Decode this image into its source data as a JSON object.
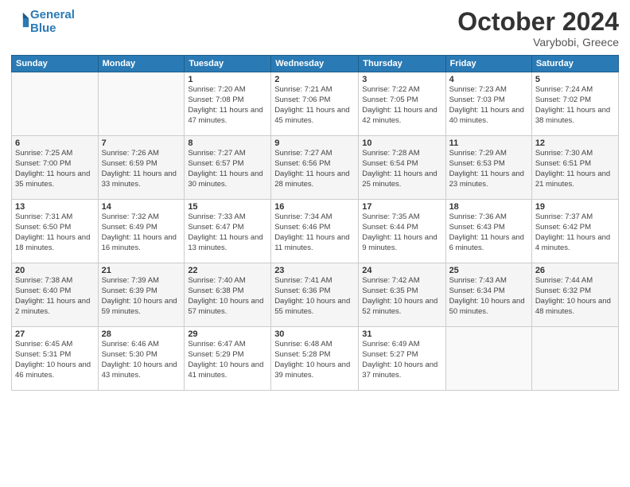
{
  "header": {
    "logo_line1": "General",
    "logo_line2": "Blue",
    "month": "October 2024",
    "location": "Varybobi, Greece"
  },
  "weekdays": [
    "Sunday",
    "Monday",
    "Tuesday",
    "Wednesday",
    "Thursday",
    "Friday",
    "Saturday"
  ],
  "weeks": [
    [
      {
        "day": "",
        "info": ""
      },
      {
        "day": "",
        "info": ""
      },
      {
        "day": "1",
        "info": "Sunrise: 7:20 AM\nSunset: 7:08 PM\nDaylight: 11 hours and 47 minutes."
      },
      {
        "day": "2",
        "info": "Sunrise: 7:21 AM\nSunset: 7:06 PM\nDaylight: 11 hours and 45 minutes."
      },
      {
        "day": "3",
        "info": "Sunrise: 7:22 AM\nSunset: 7:05 PM\nDaylight: 11 hours and 42 minutes."
      },
      {
        "day": "4",
        "info": "Sunrise: 7:23 AM\nSunset: 7:03 PM\nDaylight: 11 hours and 40 minutes."
      },
      {
        "day": "5",
        "info": "Sunrise: 7:24 AM\nSunset: 7:02 PM\nDaylight: 11 hours and 38 minutes."
      }
    ],
    [
      {
        "day": "6",
        "info": "Sunrise: 7:25 AM\nSunset: 7:00 PM\nDaylight: 11 hours and 35 minutes."
      },
      {
        "day": "7",
        "info": "Sunrise: 7:26 AM\nSunset: 6:59 PM\nDaylight: 11 hours and 33 minutes."
      },
      {
        "day": "8",
        "info": "Sunrise: 7:27 AM\nSunset: 6:57 PM\nDaylight: 11 hours and 30 minutes."
      },
      {
        "day": "9",
        "info": "Sunrise: 7:27 AM\nSunset: 6:56 PM\nDaylight: 11 hours and 28 minutes."
      },
      {
        "day": "10",
        "info": "Sunrise: 7:28 AM\nSunset: 6:54 PM\nDaylight: 11 hours and 25 minutes."
      },
      {
        "day": "11",
        "info": "Sunrise: 7:29 AM\nSunset: 6:53 PM\nDaylight: 11 hours and 23 minutes."
      },
      {
        "day": "12",
        "info": "Sunrise: 7:30 AM\nSunset: 6:51 PM\nDaylight: 11 hours and 21 minutes."
      }
    ],
    [
      {
        "day": "13",
        "info": "Sunrise: 7:31 AM\nSunset: 6:50 PM\nDaylight: 11 hours and 18 minutes."
      },
      {
        "day": "14",
        "info": "Sunrise: 7:32 AM\nSunset: 6:49 PM\nDaylight: 11 hours and 16 minutes."
      },
      {
        "day": "15",
        "info": "Sunrise: 7:33 AM\nSunset: 6:47 PM\nDaylight: 11 hours and 13 minutes."
      },
      {
        "day": "16",
        "info": "Sunrise: 7:34 AM\nSunset: 6:46 PM\nDaylight: 11 hours and 11 minutes."
      },
      {
        "day": "17",
        "info": "Sunrise: 7:35 AM\nSunset: 6:44 PM\nDaylight: 11 hours and 9 minutes."
      },
      {
        "day": "18",
        "info": "Sunrise: 7:36 AM\nSunset: 6:43 PM\nDaylight: 11 hours and 6 minutes."
      },
      {
        "day": "19",
        "info": "Sunrise: 7:37 AM\nSunset: 6:42 PM\nDaylight: 11 hours and 4 minutes."
      }
    ],
    [
      {
        "day": "20",
        "info": "Sunrise: 7:38 AM\nSunset: 6:40 PM\nDaylight: 11 hours and 2 minutes."
      },
      {
        "day": "21",
        "info": "Sunrise: 7:39 AM\nSunset: 6:39 PM\nDaylight: 10 hours and 59 minutes."
      },
      {
        "day": "22",
        "info": "Sunrise: 7:40 AM\nSunset: 6:38 PM\nDaylight: 10 hours and 57 minutes."
      },
      {
        "day": "23",
        "info": "Sunrise: 7:41 AM\nSunset: 6:36 PM\nDaylight: 10 hours and 55 minutes."
      },
      {
        "day": "24",
        "info": "Sunrise: 7:42 AM\nSunset: 6:35 PM\nDaylight: 10 hours and 52 minutes."
      },
      {
        "day": "25",
        "info": "Sunrise: 7:43 AM\nSunset: 6:34 PM\nDaylight: 10 hours and 50 minutes."
      },
      {
        "day": "26",
        "info": "Sunrise: 7:44 AM\nSunset: 6:32 PM\nDaylight: 10 hours and 48 minutes."
      }
    ],
    [
      {
        "day": "27",
        "info": "Sunrise: 6:45 AM\nSunset: 5:31 PM\nDaylight: 10 hours and 46 minutes."
      },
      {
        "day": "28",
        "info": "Sunrise: 6:46 AM\nSunset: 5:30 PM\nDaylight: 10 hours and 43 minutes."
      },
      {
        "day": "29",
        "info": "Sunrise: 6:47 AM\nSunset: 5:29 PM\nDaylight: 10 hours and 41 minutes."
      },
      {
        "day": "30",
        "info": "Sunrise: 6:48 AM\nSunset: 5:28 PM\nDaylight: 10 hours and 39 minutes."
      },
      {
        "day": "31",
        "info": "Sunrise: 6:49 AM\nSunset: 5:27 PM\nDaylight: 10 hours and 37 minutes."
      },
      {
        "day": "",
        "info": ""
      },
      {
        "day": "",
        "info": ""
      }
    ]
  ]
}
